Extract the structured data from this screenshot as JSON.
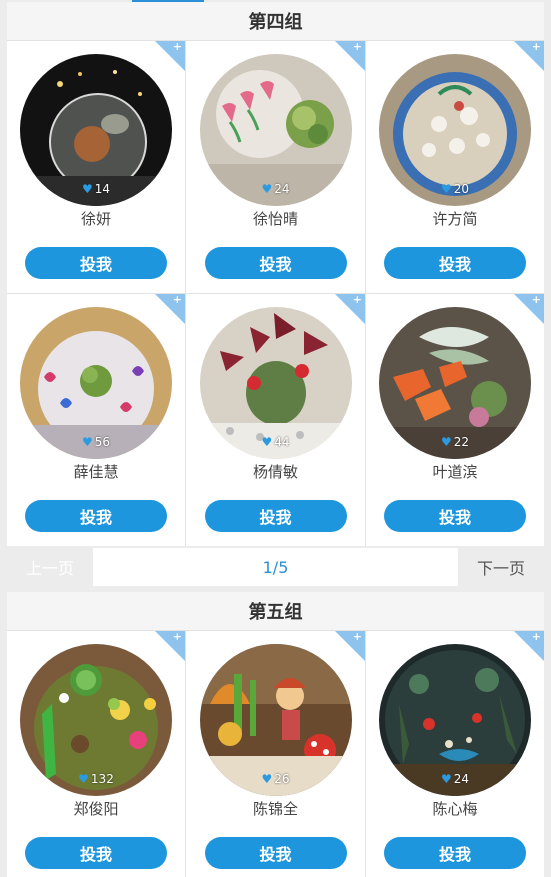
{
  "group4": {
    "title": "第四组",
    "items": [
      {
        "name": "徐妍",
        "likes": "14",
        "vote_label": "投我",
        "photo": "terrarium-ball-night-photo"
      },
      {
        "name": "徐怡晴",
        "likes": "24",
        "vote_label": "投我",
        "photo": "succulent-painted-tulip-bowl-photo"
      },
      {
        "name": "许方简",
        "likes": "20",
        "vote_label": "投我",
        "photo": "pebble-dome-terrarium-photo"
      },
      {
        "name": "薛佳慧",
        "likes": "56",
        "vote_label": "投我",
        "photo": "painted-glass-ball-succulent-photo"
      },
      {
        "name": "杨倩敏",
        "likes": "44",
        "vote_label": "投我",
        "photo": "cactus-red-leaves-terrarium-photo"
      },
      {
        "name": "叶道滨",
        "likes": "22",
        "vote_label": "投我",
        "photo": "orange-flower-fittonia-terrarium-photo"
      }
    ]
  },
  "pagination": {
    "prev_label": "上一页",
    "page_indicator": "1/5",
    "next_label": "下一页"
  },
  "group5": {
    "title": "第五组",
    "items": [
      {
        "name": "郑俊阳",
        "likes": "132",
        "vote_label": "投我",
        "photo": "moss-garden-figures-photo"
      },
      {
        "name": "陈锦全",
        "likes": "26",
        "vote_label": "投我",
        "photo": "mushroom-figure-scene-photo"
      },
      {
        "name": "陈心梅",
        "likes": "24",
        "vote_label": "投我",
        "photo": "dark-forest-glass-globe-photo"
      }
    ]
  },
  "colors": {
    "accent": "#1e96dd",
    "corner": "#8dc3ec",
    "heart": "#2a9be0"
  }
}
